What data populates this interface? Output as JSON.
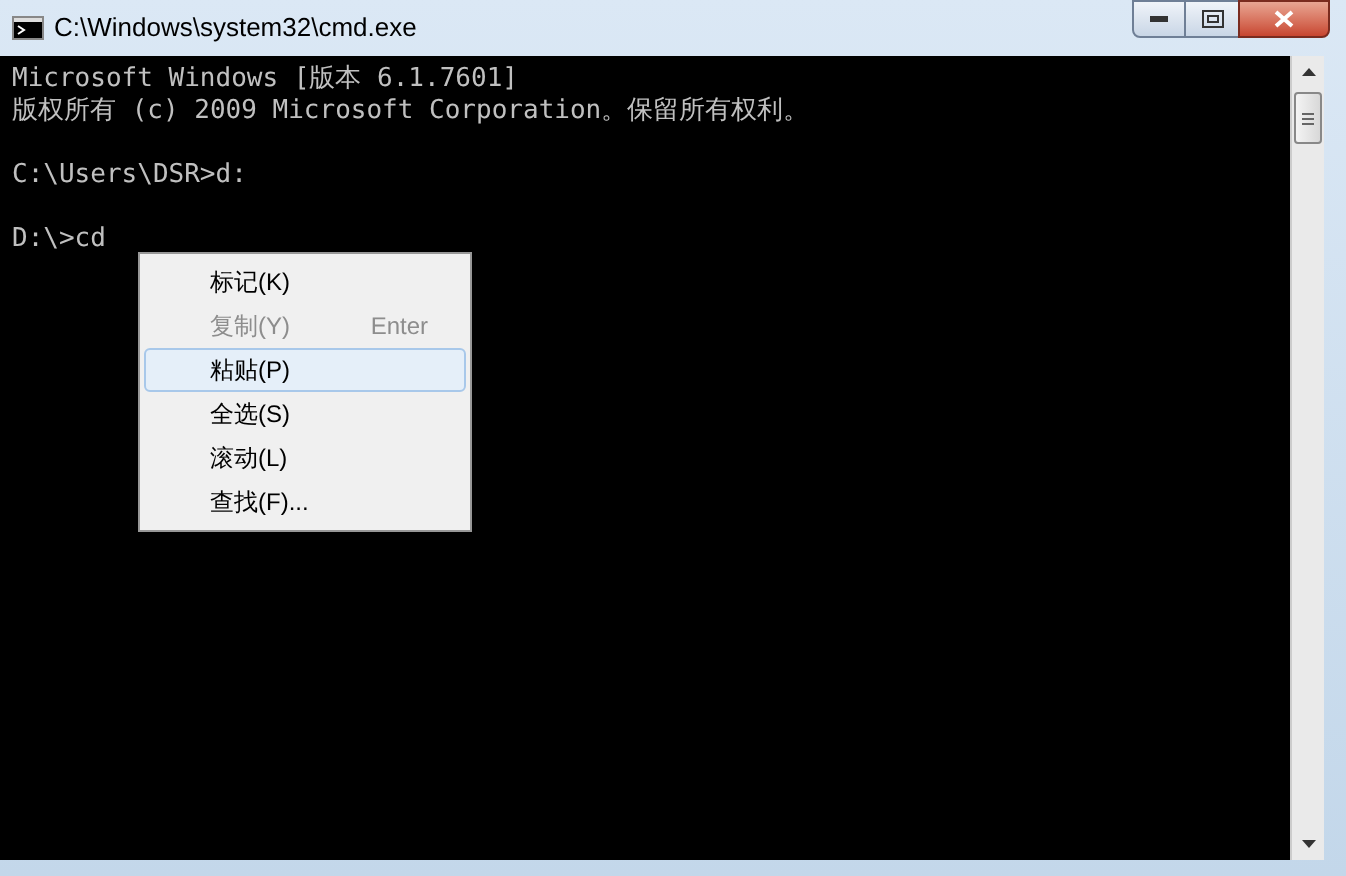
{
  "window": {
    "title": "C:\\Windows\\system32\\cmd.exe"
  },
  "console": {
    "lines": [
      {
        "kind": "text",
        "text": "Microsoft Windows [版本 6.1.7601]"
      },
      {
        "kind": "text",
        "text": "版权所有 (c) 2009 Microsoft Corporation。保留所有权利。"
      },
      {
        "kind": "blank"
      },
      {
        "kind": "text",
        "text": "C:\\Users\\DSR>d:"
      },
      {
        "kind": "blank"
      },
      {
        "kind": "text",
        "text": "D:\\>cd"
      }
    ]
  },
  "context_menu": {
    "items": [
      {
        "label": "标记(K)",
        "disabled": false,
        "selected": false
      },
      {
        "label": "复制(Y)",
        "shortcut": "Enter",
        "disabled": true,
        "selected": false
      },
      {
        "label": "粘贴(P)",
        "disabled": false,
        "selected": true
      },
      {
        "label": "全选(S)",
        "disabled": false,
        "selected": false
      },
      {
        "label": "滚动(L)",
        "disabled": false,
        "selected": false
      },
      {
        "label": "查找(F)...",
        "disabled": false,
        "selected": false
      }
    ]
  }
}
